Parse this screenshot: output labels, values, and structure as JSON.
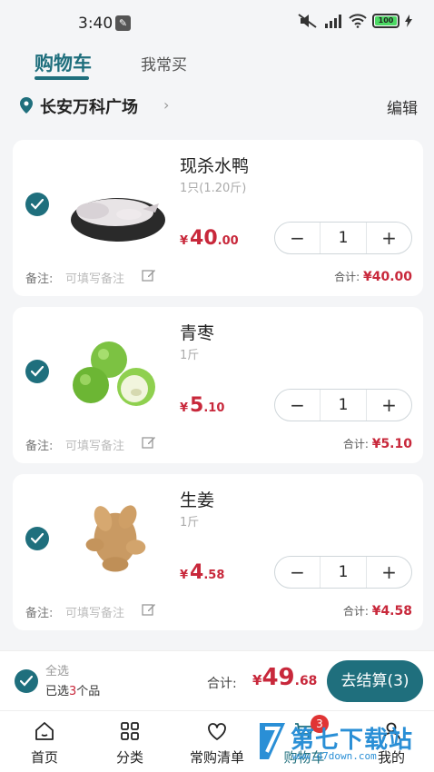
{
  "status_bar": {
    "time": "3:40",
    "battery": "100"
  },
  "tabs": {
    "cart": "购物车",
    "frequent": "我常买"
  },
  "location": {
    "name": "长安万科广场",
    "edit": "编辑"
  },
  "items": [
    {
      "name": "现杀水鸭",
      "spec": "1只(1.20斤)",
      "price_yen": "¥",
      "price_int": "40",
      "price_dec": ".00",
      "qty": "1",
      "minus": "−",
      "plus": "+",
      "note_label": "备注:",
      "note_placeholder": "可填写备注",
      "subtotal_label": "合计:",
      "subtotal": "¥40.00"
    },
    {
      "name": "青枣",
      "spec": "1斤",
      "price_yen": "¥",
      "price_int": "5",
      "price_dec": ".10",
      "qty": "1",
      "minus": "−",
      "plus": "+",
      "note_label": "备注:",
      "note_placeholder": "可填写备注",
      "subtotal_label": "合计:",
      "subtotal": "¥5.10"
    },
    {
      "name": "生姜",
      "spec": "1斤",
      "price_yen": "¥",
      "price_int": "4",
      "price_dec": ".58",
      "qty": "1",
      "minus": "−",
      "plus": "+",
      "note_label": "备注:",
      "note_placeholder": "可填写备注",
      "subtotal_label": "合计:",
      "subtotal": "¥4.58"
    }
  ],
  "checkout": {
    "select_all": "全选",
    "selected_prefix": "已选",
    "selected_count": "3",
    "selected_suffix": "个品",
    "total_label": "合计:",
    "total_yen": "¥",
    "total_int": "49",
    "total_dec": ".68",
    "button": "去结算(3)"
  },
  "tab_bar": [
    {
      "label": "首页",
      "icon": "home-icon"
    },
    {
      "label": "分类",
      "icon": "grid-icon"
    },
    {
      "label": "常购清单",
      "icon": "heart-icon"
    },
    {
      "label": "购物车",
      "icon": "cart-icon",
      "badge": "3"
    },
    {
      "label": "我的",
      "icon": "user-icon"
    }
  ],
  "watermark": {
    "title": "第七下载站",
    "url": "www.d7down.com"
  },
  "colors": {
    "accent": "#1f6f7d",
    "price": "#c8283b",
    "badge": "#e03434"
  }
}
